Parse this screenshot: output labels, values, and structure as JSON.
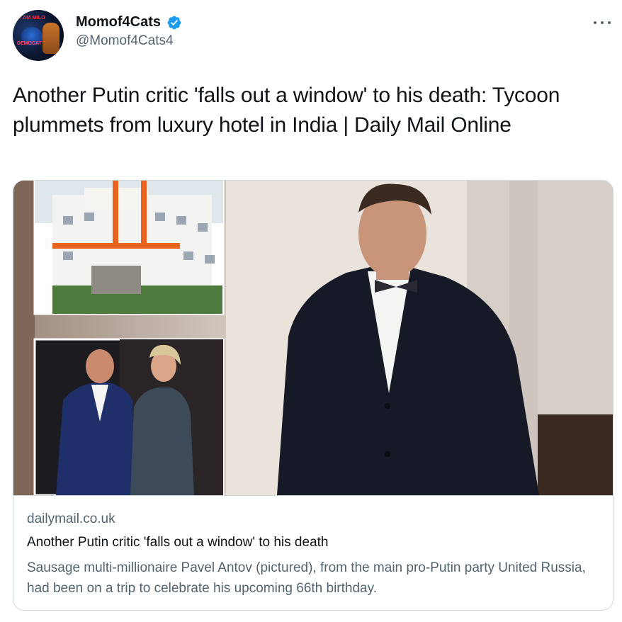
{
  "author": {
    "display_name": "Momof4Cats",
    "handle": "@Momof4Cats4",
    "verified": true,
    "avatar_text_top": "I AM MILO",
    "avatar_text_mid": "DEMOCAT"
  },
  "tweet": {
    "text": "Another Putin critic 'falls out a window' to his death: Tycoon plummets from luxury hotel in India | Daily Mail Online"
  },
  "card": {
    "domain": "dailymail.co.uk",
    "title": "Another Putin critic 'falls out a window' to his death",
    "description": "Sausage multi-millionaire Pavel Antov (pictured), from the main pro-Putin party United Russia, had been on a trip to celebrate his upcoming 66th birthday."
  },
  "icons": {
    "verified": "verified-badge-icon",
    "more": "more-options-icon"
  },
  "colors": {
    "verified_blue": "#1d9bf0",
    "secondary_text": "#536471",
    "border": "#cfd9de"
  }
}
